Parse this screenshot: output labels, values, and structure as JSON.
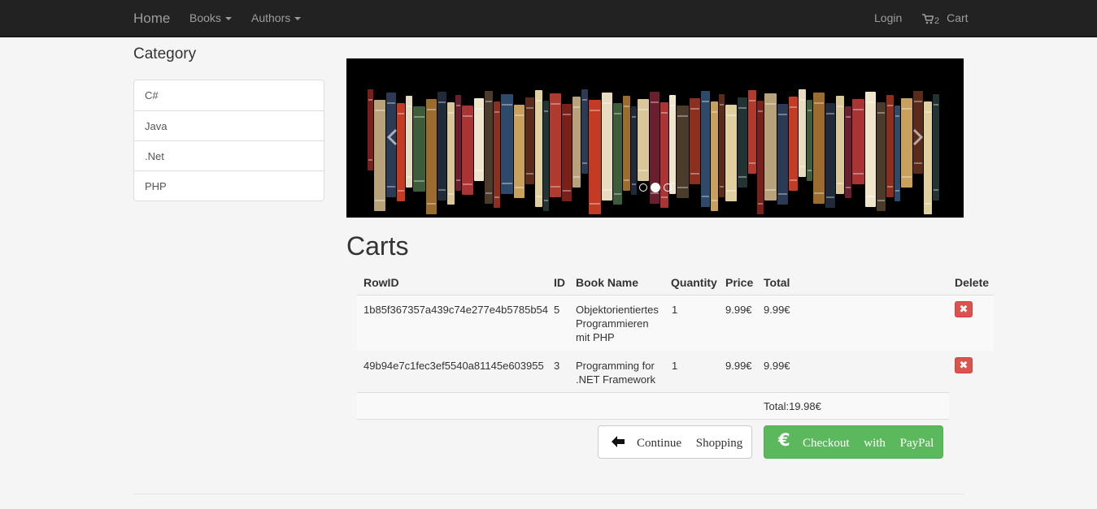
{
  "navbar": {
    "brand": "Home",
    "books_label": "Books",
    "authors_label": "Authors",
    "login_label": "Login",
    "cart_count": "2",
    "cart_label": "Cart"
  },
  "sidebar": {
    "title": "Category",
    "items": [
      {
        "label": "C#"
      },
      {
        "label": "Java"
      },
      {
        "label": ".Net"
      },
      {
        "label": "PHP"
      }
    ]
  },
  "carousel": {
    "slides": 3,
    "active_slide": 2
  },
  "carts": {
    "title": "Carts",
    "columns": [
      "RowID",
      "ID",
      "Book Name",
      "Quantity",
      "Price",
      "Total",
      "Delete"
    ],
    "rows": [
      {
        "rowid": "1b85f367357a439c74e277e4b5785b54",
        "id": "5",
        "name": "Objektorientiertes Programmieren mit PHP",
        "quantity": "1",
        "price": "9.99€",
        "total": "9.99€"
      },
      {
        "rowid": "49b94e7c1fec3ef5540a81145e603955",
        "id": "3",
        "name": "Programming for .NET Framework",
        "quantity": "1",
        "price": "9.99€",
        "total": "9.99€"
      }
    ],
    "grand_total": "Total:19.98€",
    "continue_label": "Continue Shopping",
    "checkout_label": "Checkout with PayPal",
    "checkout_icon": "€"
  },
  "colors": {
    "navbar": "#222222",
    "danger": "#d9534f",
    "success": "#5cb85c"
  }
}
